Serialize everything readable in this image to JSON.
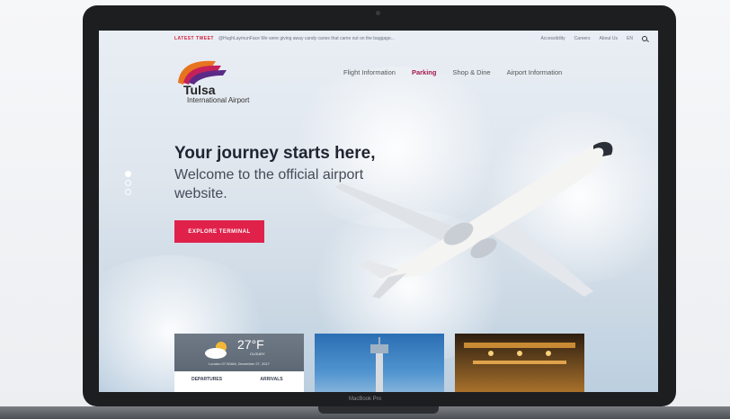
{
  "topbar": {
    "tweet_label": "LATEST TWEET",
    "tweet_text": "@HughLaymunFace We were giving away candy canes that came out on the baggage...",
    "links": [
      "Accessibility",
      "Careers",
      "About Us",
      "EN"
    ]
  },
  "logo": {
    "name": "Tulsa",
    "sub": "International Airport"
  },
  "nav": {
    "items": [
      "Flight Information",
      "Parking",
      "Shop & Dine",
      "Airport Information"
    ],
    "active": "Parking"
  },
  "hero": {
    "title": "Your journey starts here,",
    "subtitle": "Welcome to the official airport website.",
    "cta": "EXPLORE TERMINAL"
  },
  "weather": {
    "temp": "27°F",
    "condition": "CLOUDY",
    "date": "London 07:30AM, December 27, 2017",
    "tabs": [
      "DEPARTURES",
      "ARRIVALS"
    ]
  },
  "device": {
    "model": "MacBook Pro"
  },
  "colors": {
    "accent": "#e0224b",
    "nav_active": "#a3194d"
  }
}
